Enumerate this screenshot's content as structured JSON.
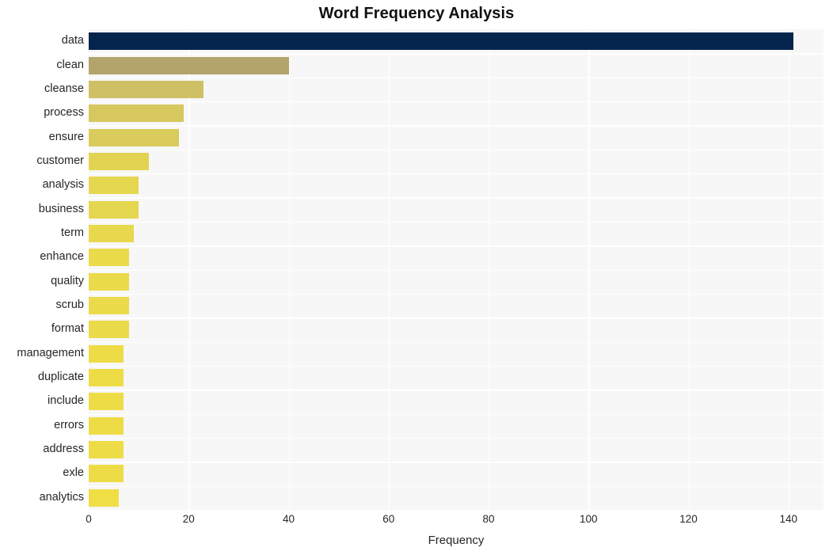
{
  "chart_data": {
    "type": "bar",
    "orientation": "horizontal",
    "title": "Word Frequency Analysis",
    "xlabel": "Frequency",
    "ylabel": "",
    "xlim": [
      0,
      147
    ],
    "xticks": [
      0,
      20,
      40,
      60,
      80,
      100,
      120,
      140
    ],
    "xtick_labels": [
      "0",
      "20",
      "40",
      "60",
      "80",
      "100",
      "120",
      "140"
    ],
    "grid": true,
    "grid_color": "#ffffff",
    "plot_background": "#f7f7f7",
    "legend": null,
    "categories": [
      "data",
      "clean",
      "cleanse",
      "process",
      "ensure",
      "customer",
      "analysis",
      "business",
      "term",
      "enhance",
      "quality",
      "scrub",
      "format",
      "management",
      "duplicate",
      "include",
      "errors",
      "address",
      "exle",
      "analytics"
    ],
    "values": [
      141,
      40,
      23,
      19,
      18,
      12,
      10,
      10,
      9,
      8,
      8,
      8,
      8,
      7,
      7,
      7,
      7,
      7,
      7,
      6
    ],
    "bar_colors": [
      "#04244c",
      "#b2a46b",
      "#cfc065",
      "#d6c85f",
      "#d9cb5c",
      "#e2d452",
      "#e5d64f",
      "#e5d64f",
      "#e8d84d",
      "#ebda4a",
      "#ebda4a",
      "#ebda4a",
      "#ebda4a",
      "#eedc47",
      "#eedc47",
      "#eedc47",
      "#eedc47",
      "#eedc47",
      "#eedc47",
      "#f0de45"
    ]
  }
}
